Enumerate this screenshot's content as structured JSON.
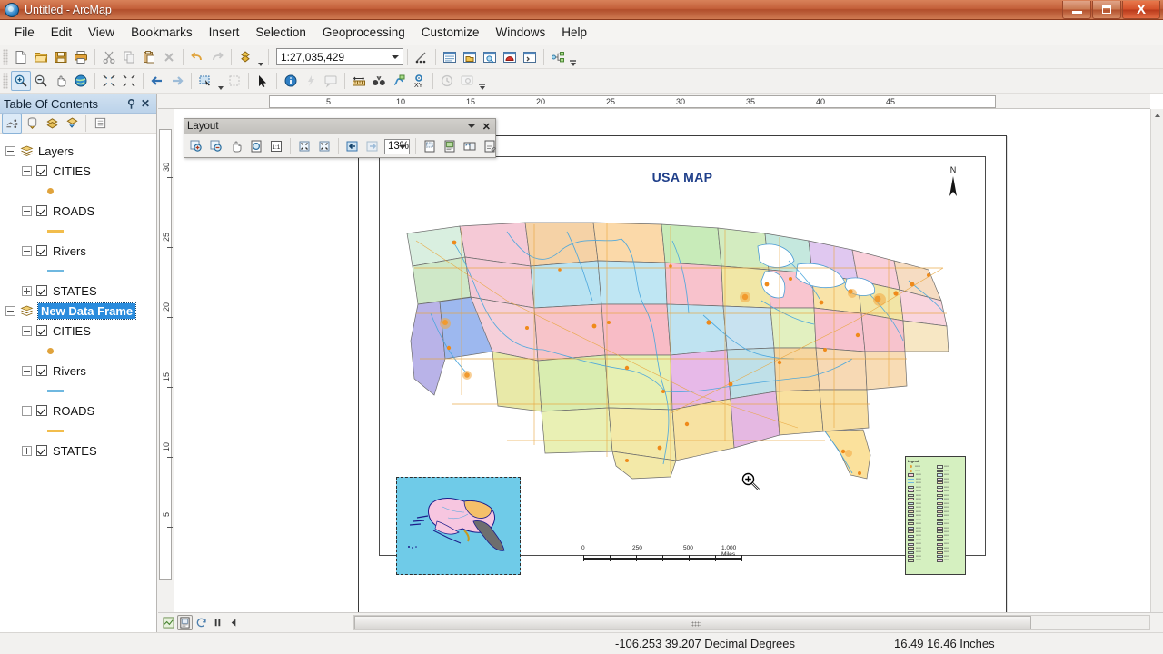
{
  "window": {
    "title": "Untitled - ArcMap",
    "app_icon": "globe-icon",
    "minimize_label": "Minimize",
    "maximize_label": "Restore",
    "close_label": "X"
  },
  "menubar": {
    "items": [
      {
        "label": "File"
      },
      {
        "label": "Edit"
      },
      {
        "label": "View"
      },
      {
        "label": "Bookmarks"
      },
      {
        "label": "Insert"
      },
      {
        "label": "Selection"
      },
      {
        "label": "Geoprocessing"
      },
      {
        "label": "Customize"
      },
      {
        "label": "Windows"
      },
      {
        "label": "Help"
      }
    ]
  },
  "standard_toolbar": {
    "scale_value": "1:27,035,429",
    "buttons": [
      {
        "name": "new-map-file-icon",
        "title": "New"
      },
      {
        "name": "open-folder-icon",
        "title": "Open"
      },
      {
        "name": "save-disk-icon",
        "title": "Save"
      },
      {
        "name": "print-icon",
        "title": "Print"
      },
      {
        "name": "cut-scissors-icon",
        "title": "Cut"
      },
      {
        "name": "copy-icon",
        "title": "Copy"
      },
      {
        "name": "paste-icon",
        "title": "Paste"
      },
      {
        "name": "delete-x-icon",
        "title": "Delete"
      },
      {
        "name": "undo-arrow-icon",
        "title": "Undo"
      },
      {
        "name": "redo-arrow-icon",
        "title": "Redo"
      },
      {
        "name": "add-data-icon",
        "title": "Add Data"
      },
      {
        "name": "editor-toolbar-icon",
        "title": "Editor Toolbar"
      },
      {
        "name": "table-of-contents-icon",
        "title": "Table Of Contents"
      },
      {
        "name": "catalog-window-icon",
        "title": "Catalog"
      },
      {
        "name": "search-window-icon",
        "title": "Search"
      },
      {
        "name": "arctoolbox-icon",
        "title": "ArcToolbox"
      },
      {
        "name": "python-window-icon",
        "title": "Python Window"
      },
      {
        "name": "model-builder-icon",
        "title": "ModelBuilder"
      }
    ]
  },
  "tools_toolbar": {
    "buttons": [
      {
        "name": "zoom-in-icon",
        "title": "Zoom In",
        "selected": true
      },
      {
        "name": "zoom-out-icon",
        "title": "Zoom Out",
        "selected": false
      },
      {
        "name": "pan-hand-icon",
        "title": "Pan",
        "selected": false
      },
      {
        "name": "full-extent-globe-icon",
        "title": "Full Extent",
        "selected": false
      },
      {
        "name": "fixed-zoom-in-icon",
        "title": "Fixed Zoom In",
        "selected": false
      },
      {
        "name": "fixed-zoom-out-icon",
        "title": "Fixed Zoom Out",
        "selected": false
      },
      {
        "name": "go-back-extent-icon",
        "title": "Go Back To Previous Extent",
        "selected": false
      },
      {
        "name": "go-forward-extent-icon",
        "title": "Go To Next Extent",
        "selected": false
      },
      {
        "name": "select-features-icon",
        "title": "Select Features",
        "selected": false
      },
      {
        "name": "clear-selection-icon",
        "title": "Clear Selected Features",
        "selected": false
      },
      {
        "name": "select-elements-arrow-icon",
        "title": "Select Elements",
        "selected": false
      },
      {
        "name": "identify-icon",
        "title": "Identify",
        "selected": false
      },
      {
        "name": "hyperlink-icon",
        "title": "Hyperlink",
        "selected": false
      },
      {
        "name": "html-popup-icon",
        "title": "HTML Popup",
        "selected": false
      },
      {
        "name": "measure-icon",
        "title": "Measure",
        "selected": false
      },
      {
        "name": "find-binoculars-icon",
        "title": "Find",
        "selected": false
      },
      {
        "name": "find-route-icon",
        "title": "Find Route",
        "selected": false
      },
      {
        "name": "go-to-xy-icon",
        "title": "Go To XY",
        "selected": false
      },
      {
        "name": "time-slider-icon",
        "title": "Time Slider",
        "selected": false
      },
      {
        "name": "create-viewer-window-icon",
        "title": "Create Viewer Window",
        "selected": false
      }
    ]
  },
  "toc": {
    "title": "Table Of Contents",
    "pin_icon": "pin-icon",
    "close_icon": "close-icon",
    "toolbar_buttons": [
      {
        "name": "list-by-drawing-order-icon",
        "title": "List By Drawing Order",
        "selected": true
      },
      {
        "name": "list-by-source-icon",
        "title": "List By Source",
        "selected": false
      },
      {
        "name": "list-by-visibility-icon",
        "title": "List By Visibility",
        "selected": false
      },
      {
        "name": "list-by-selection-icon",
        "title": "List By Selection",
        "selected": false
      },
      {
        "name": "toc-options-icon",
        "title": "Options",
        "selected": false
      }
    ],
    "tree": [
      {
        "label": "Layers",
        "type": "dataframe",
        "expander": "minus",
        "selected": false,
        "children": [
          {
            "label": "CITIES",
            "expander": "minus",
            "checked": true,
            "symbol": "dot",
            "symbol_color": "#e0a33c"
          },
          {
            "label": "ROADS",
            "expander": "minus",
            "checked": true,
            "symbol": "line",
            "symbol_color": "#f2bd4c"
          },
          {
            "label": "Rivers",
            "expander": "minus",
            "checked": true,
            "symbol": "line",
            "symbol_color": "#6fb8e0"
          },
          {
            "label": "STATES",
            "expander": "plus",
            "checked": true,
            "symbol": "none",
            "symbol_color": ""
          }
        ]
      },
      {
        "label": "New Data Frame",
        "type": "dataframe",
        "expander": "minus",
        "selected": true,
        "children": [
          {
            "label": "CITIES",
            "expander": "minus",
            "checked": true,
            "symbol": "dot",
            "symbol_color": "#e0a33c"
          },
          {
            "label": "Rivers",
            "expander": "minus",
            "checked": true,
            "symbol": "line",
            "symbol_color": "#6fb8e0"
          },
          {
            "label": "ROADS",
            "expander": "minus",
            "checked": true,
            "symbol": "line",
            "symbol_color": "#f2bd4c"
          },
          {
            "label": "STATES",
            "expander": "plus",
            "checked": true,
            "symbol": "none",
            "symbol_color": ""
          }
        ]
      }
    ]
  },
  "layout_toolbar": {
    "title": "Layout",
    "zoom_value": "13%",
    "menu_caret_icon": "chevron-down-icon",
    "close_icon": "close-icon",
    "buttons": [
      {
        "name": "layout-zoom-in-icon",
        "title": "Zoom In"
      },
      {
        "name": "layout-zoom-out-icon",
        "title": "Zoom Out"
      },
      {
        "name": "layout-pan-icon",
        "title": "Pan"
      },
      {
        "name": "zoom-whole-page-icon",
        "title": "Zoom Whole Page"
      },
      {
        "name": "zoom-100-percent-icon",
        "title": "Zoom to 100%"
      },
      {
        "name": "fixed-zoom-in-page-icon",
        "title": "Fixed Zoom In"
      },
      {
        "name": "fixed-zoom-out-page-icon",
        "title": "Fixed Zoom Out"
      },
      {
        "name": "go-back-extent-icon",
        "title": "Go Back To Extent"
      },
      {
        "name": "go-forward-extent-icon",
        "title": "Go Forward To Extent"
      },
      {
        "name": "focus-data-frame-icon",
        "title": "Focus Data Frame"
      },
      {
        "name": "change-layout-icon",
        "title": "Change Layout"
      },
      {
        "name": "data-driven-pages-icon",
        "title": "Data Driven Pages"
      },
      {
        "name": "toggle-draft-mode-icon",
        "title": "Toggle Draft Mode"
      }
    ]
  },
  "rulers": {
    "horizontal_ticks": [
      "5",
      "10",
      "15",
      "20",
      "25",
      "30",
      "35",
      "40",
      "45"
    ],
    "vertical_ticks": [
      "30",
      "25",
      "20",
      "15",
      "10",
      "5"
    ]
  },
  "layout_page": {
    "map_title": "USA MAP",
    "north_arrow_label": "N",
    "scalebar": {
      "labels": [
        "0",
        "250",
        "500",
        "1,000 Miles"
      ]
    },
    "legend": {
      "title": "Legend",
      "entry_count": 48
    },
    "inset_name": "alaska-inset"
  },
  "view_buttons": [
    {
      "name": "data-view-button",
      "title": "Data View",
      "selected": false
    },
    {
      "name": "layout-view-button",
      "title": "Layout View",
      "selected": true
    },
    {
      "name": "refresh-view-button",
      "title": "Refresh View",
      "selected": false
    },
    {
      "name": "pause-drawing-button",
      "title": "Pause Drawing",
      "selected": false
    },
    {
      "name": "toggle-draw-button",
      "title": "Toggle Draw",
      "selected": false
    }
  ],
  "statusbar": {
    "coordinates": "-106.253  39.207 Decimal Degrees",
    "page_units": "16.49  16.46 Inches"
  },
  "colors": {
    "titlebar_accent": "#c4603a",
    "selection_blue": "#2a8cdd",
    "map_title_blue": "#1f3f8a",
    "inset_water": "#6fcbe8",
    "legend_bg": "#d5f0c0"
  }
}
